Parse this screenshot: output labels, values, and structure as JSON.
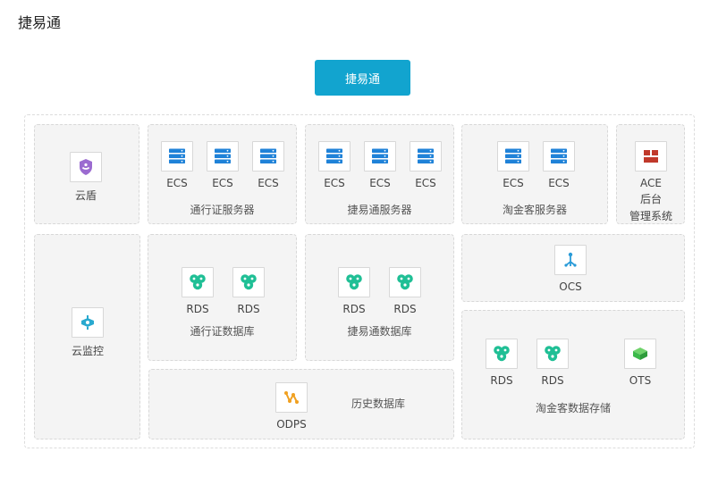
{
  "page_title": "捷易通",
  "top_button": "捷易通",
  "yundun": "云盾",
  "yunjiankong": "云监控",
  "ecs_label": "ECS",
  "rds_label": "RDS",
  "tongxingzheng_servers": "通行证服务器",
  "jieyitong_servers": "捷易通服务器",
  "taojinke_servers": "淘金客服务器",
  "ace_line1": "ACE",
  "ace_line2": "后台",
  "ace_line3": "管理系统",
  "tongxingzheng_db": "通行证数据库",
  "jieyitong_db": "捷易通数据库",
  "ocs_label": "OCS",
  "odps_label": "ODPS",
  "history_db": "历史数据库",
  "ots_label": "OTS",
  "taojinke_storage": "淘金客数据存储",
  "colors": {
    "accent": "#12a4cf",
    "ecs_blue": "#1f82d8",
    "rds_teal": "#1fbf95",
    "ace_red": "#c0392b",
    "odps_orange": "#f0a020",
    "ots_green": "#3cb94a",
    "ocs_blue": "#2a9bd8",
    "shield_purple": "#9b6bd0"
  },
  "icons": {
    "ecs": "server-stack-icon",
    "rds": "database-cluster-icon",
    "yundun": "shield-icon",
    "yunjiankong": "monitor-icon",
    "ace": "ace-grid-icon",
    "ocs": "cache-network-icon",
    "odps": "data-flow-icon",
    "ots": "table-store-icon"
  }
}
